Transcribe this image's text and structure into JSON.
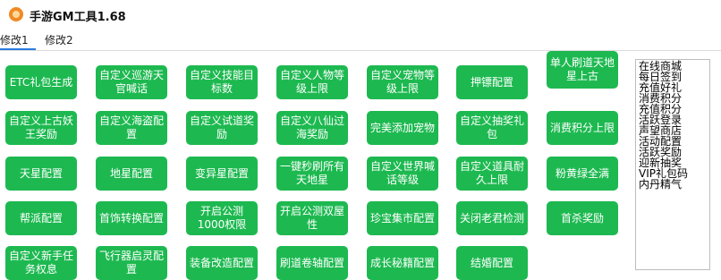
{
  "window": {
    "title": "手游GM工具1.68",
    "icon": "app-logo-icon"
  },
  "tabs": [
    "修改1",
    "修改2"
  ],
  "buttons": [
    [
      "ETC礼包生成",
      "自定义巡游天官喊话",
      "自定义技能目标数",
      "自定义人物等级上限",
      "自定义宠物等级上限",
      "押镖配置",
      "单人刷道天地星上古"
    ],
    [
      "自定义上古妖王奖励",
      "自定义海盗配置",
      "自定义试道奖励",
      "自定义八仙过海奖励",
      "完美添加宠物",
      "自定义抽奖礼包",
      "消费积分上限"
    ],
    [
      "天星配置",
      "地星配置",
      "变异星配置",
      "一键秒刷所有天地星",
      "自定义世界喊话等级",
      "自定义道具耐久上限",
      "粉黄绿全满"
    ],
    [
      "帮派配置",
      "首饰转换配置",
      "开启公测1000权限",
      "开启公测双屋性",
      "珍宝集市配置",
      "关闭老君检测",
      "首杀奖励"
    ],
    [
      "自定义新手任务权息",
      "飞行器启灵配置",
      "装备改造配置",
      "刷道卷轴配置",
      "成长秘籍配置",
      "结婚配置"
    ]
  ],
  "list": [
    "在线商城",
    "每日签到",
    "充值好礼",
    "消费积分",
    "充值积分",
    "活跃登录",
    "声望商店",
    "活动配置",
    "活跃奖励",
    "迎新抽奖",
    "VIP礼包码",
    "内丹精气"
  ]
}
